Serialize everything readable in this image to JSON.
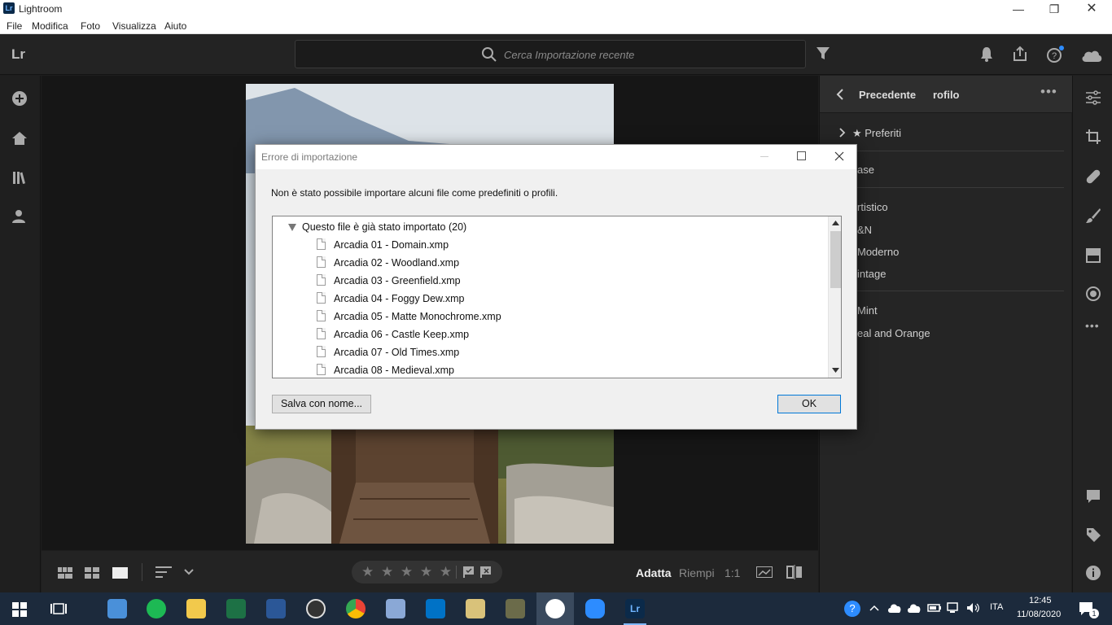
{
  "window": {
    "title": "Lightroom",
    "logo_text": "Lr",
    "controls": {
      "minimize": "—",
      "restore": "❐",
      "close": "✕"
    }
  },
  "menu": [
    "File",
    "Modifica",
    "Foto",
    "Visualizza",
    "Aiuto"
  ],
  "topbar": {
    "logo": "Lr",
    "search_placeholder": "Cerca Importazione recente"
  },
  "right_panel": {
    "back_label": "Precedente",
    "profile_label": "rofilo",
    "items": [
      {
        "label": "★  Preferiti"
      },
      {
        "label": "ase"
      },
      {
        "label": "rtistico"
      },
      {
        "label": "&N"
      },
      {
        "label": "Moderno"
      },
      {
        "label": "intage"
      },
      {
        "label": "Mint"
      },
      {
        "label": "eal and Orange"
      }
    ]
  },
  "bottom": {
    "fit_label": "Adatta",
    "fill_label": "Riempi",
    "ratio_label": "1:1",
    "stars": "★ ★ ★ ★ ★"
  },
  "dialog": {
    "title": "Errore di importazione",
    "message": "Non è stato possibile importare alcuni file come predefiniti o profili.",
    "group_label": "Questo file è già stato importato (20)",
    "files": [
      "Arcadia 01 - Domain.xmp",
      "Arcadia 02 - Woodland.xmp",
      "Arcadia 03 - Greenfield.xmp",
      "Arcadia 04 - Foggy Dew.xmp",
      "Arcadia 05 - Matte Monochrome.xmp",
      "Arcadia 06 - Castle Keep.xmp",
      "Arcadia 07 - Old Times.xmp",
      "Arcadia 08 - Medieval.xmp"
    ],
    "save_button": "Salva con nome...",
    "ok_button": "OK"
  },
  "taskbar": {
    "lang": "ITA",
    "time": "12:45",
    "date": "11/08/2020",
    "notif_count": "1"
  },
  "colors": {
    "accent": "#0b2a4a",
    "panel": "#252525",
    "dialog": "#f0f0f0"
  }
}
